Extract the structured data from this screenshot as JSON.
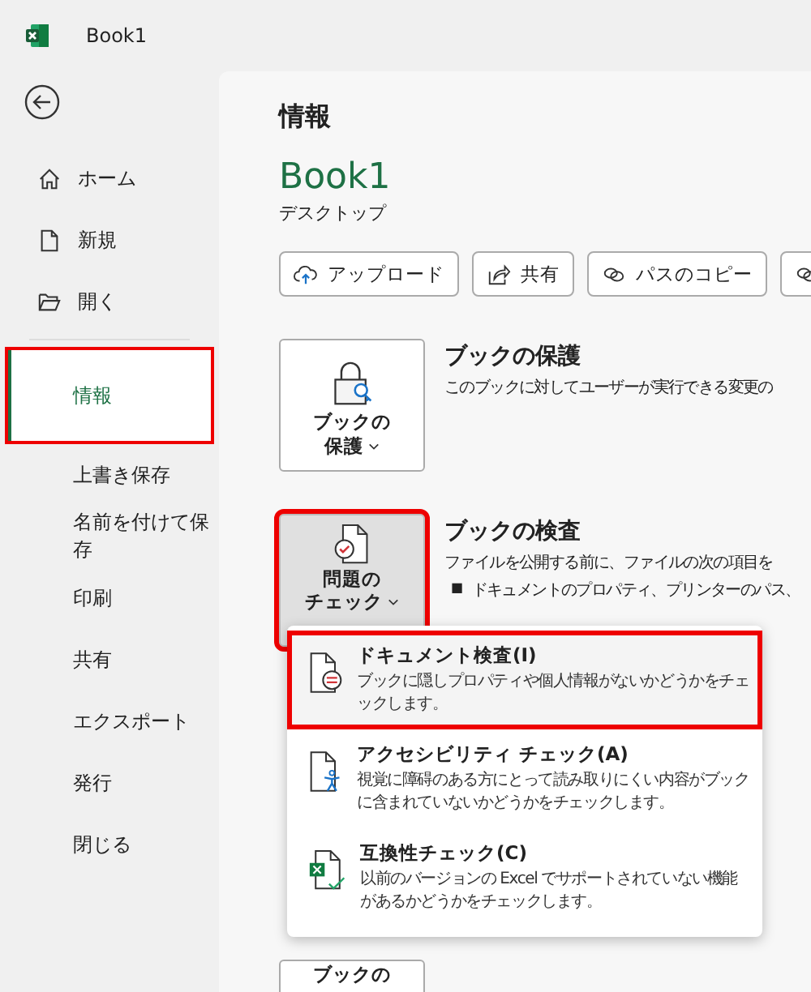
{
  "window": {
    "title": "Book1"
  },
  "sidebar": {
    "items": [
      {
        "label": "ホーム",
        "kind": "home",
        "selected": false,
        "highlighted": false
      },
      {
        "label": "新規",
        "kind": "new",
        "selected": false,
        "highlighted": false
      },
      {
        "label": "開く",
        "kind": "open",
        "selected": false,
        "highlighted": false
      },
      {
        "label": "情報",
        "kind": "plain",
        "selected": true,
        "highlighted": true
      },
      {
        "label": "上書き保存",
        "kind": "plain",
        "selected": false,
        "highlighted": false
      },
      {
        "label": "名前を付けて保存",
        "kind": "plain",
        "selected": false,
        "highlighted": false
      },
      {
        "label": "印刷",
        "kind": "plain",
        "selected": false,
        "highlighted": false
      },
      {
        "label": "共有",
        "kind": "plain",
        "selected": false,
        "highlighted": false
      },
      {
        "label": "エクスポート",
        "kind": "plain",
        "selected": false,
        "highlighted": false
      },
      {
        "label": "発行",
        "kind": "plain",
        "selected": false,
        "highlighted": false
      },
      {
        "label": "閉じる",
        "kind": "plain",
        "selected": false,
        "highlighted": false
      }
    ]
  },
  "page": {
    "title": "情報",
    "document_name": "Book1",
    "location": "デスクトップ",
    "actions": [
      {
        "label": "アップロード",
        "kind": "upload"
      },
      {
        "label": "共有",
        "kind": "share"
      },
      {
        "label": "パスのコピー",
        "kind": "link"
      },
      {
        "kind": "link"
      }
    ],
    "sections": [
      {
        "kind": "protect",
        "button_lines": [
          "ブックの",
          "保護"
        ],
        "highlighted": false,
        "pressed": false,
        "heading": "ブックの保護",
        "description": "このブックに対してユーザーが実行できる変更の"
      },
      {
        "kind": "inspect",
        "button_lines": [
          "問題の",
          "チェック"
        ],
        "highlighted": true,
        "pressed": true,
        "heading": "ブックの検査",
        "description": "ファイルを公開する前に、ファイルの次の項目を",
        "bullets": [
          "ドキュメントのプロパティ、プリンターのパス、"
        ],
        "bullet_mark": "■"
      },
      {
        "kind": "versions",
        "button_lines": [
          "ブックの"
        ],
        "highlighted": false,
        "pressed": false
      }
    ]
  },
  "dropdown": {
    "items": [
      {
        "kind": "inspect",
        "title": "ドキュメント検査(I)",
        "description": "ブックに隠しプロパティや個人情報がないかどうかをチェックします。",
        "highlighted": true
      },
      {
        "kind": "accessibility",
        "title": "アクセシビリティ チェック(A)",
        "description": "視覚に障碍のある方にとって読み取りにくい内容がブックに含まれていないかどうかをチェックします。",
        "highlighted": false
      },
      {
        "kind": "compat",
        "title": "互換性チェック(C)",
        "description": "以前のバージョンの Excel でサポートされていない機能があるかどうかをチェックします。",
        "highlighted": false
      }
    ]
  }
}
